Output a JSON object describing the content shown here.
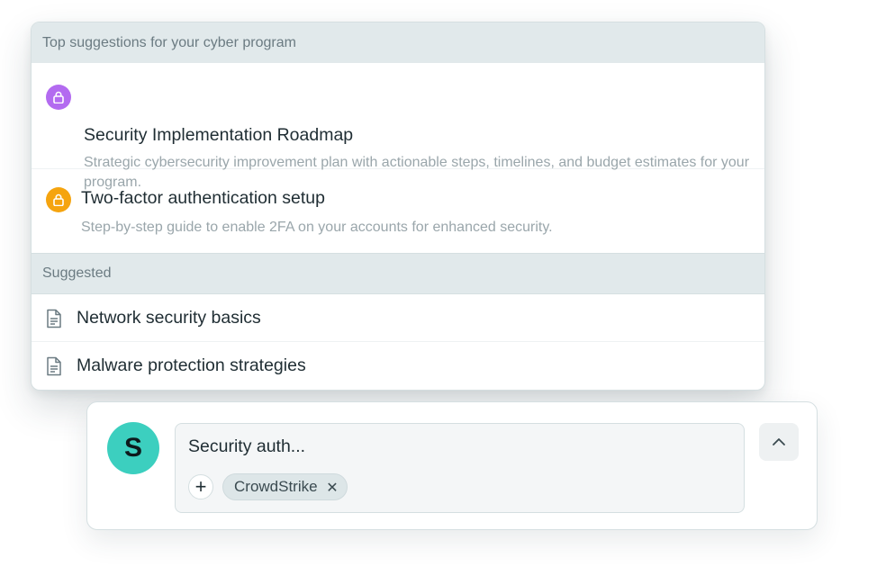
{
  "suggestions": {
    "top_header": "Top suggestions for your cyber program",
    "top_items": [
      {
        "title": "Security Implementation Roadmap",
        "description": "Strategic cybersecurity improvement plan with actionable steps, timelines, and budget estimates for your program.",
        "icon": "lock-icon",
        "badge_color": "#b36bf0"
      },
      {
        "title": "Two-factor authentication setup",
        "description": "Step-by-step guide to enable 2FA on your accounts for enhanced security.",
        "icon": "lock-icon",
        "badge_color": "#f5a40f"
      }
    ],
    "suggested_header": "Suggested",
    "suggested_items": [
      {
        "label": "Network security basics",
        "icon": "document-icon"
      },
      {
        "label": "Malware protection strategies",
        "icon": "document-icon"
      }
    ]
  },
  "composer": {
    "avatar_letter": "S",
    "avatar_color": "#3ccfbf",
    "input_value": "Security auth...",
    "add_symbol": "+",
    "chips": [
      {
        "label": "CrowdStrike",
        "remove_symbol": "✕"
      }
    ],
    "collapse_icon": "chevron-up-icon"
  }
}
